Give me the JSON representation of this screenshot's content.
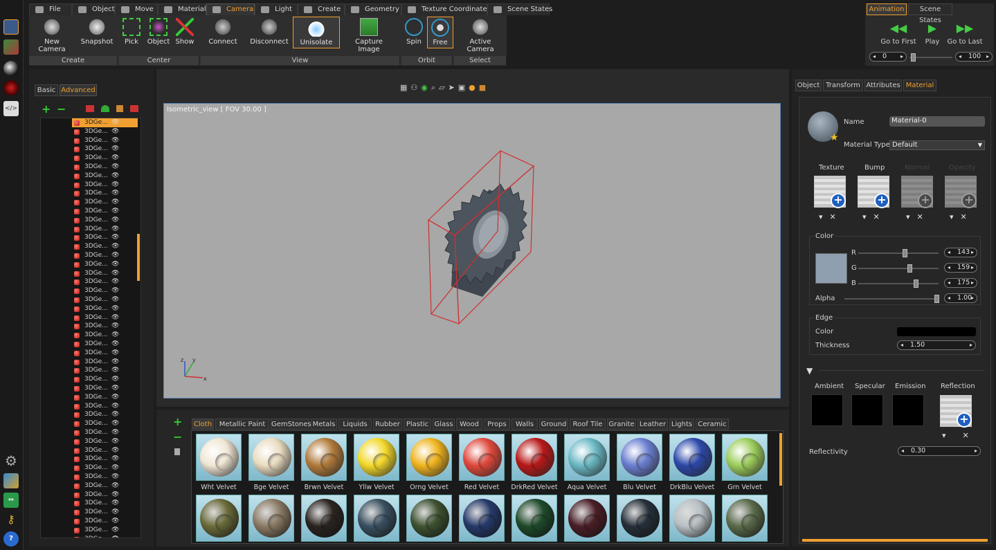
{
  "menu_tabs": [
    {
      "label": "File",
      "icon": "folder-icon"
    },
    {
      "label": "Object",
      "icon": "object-icon"
    },
    {
      "label": "Move",
      "icon": "move-icon"
    },
    {
      "label": "Material",
      "icon": "material-icon"
    },
    {
      "label": "Camera",
      "icon": "camera-icon",
      "active": true
    },
    {
      "label": "Light",
      "icon": "light-icon"
    },
    {
      "label": "Create",
      "icon": "create-icon"
    },
    {
      "label": "Geometry",
      "icon": "geometry-icon"
    },
    {
      "label": "Texture Coordinates",
      "icon": "texture-icon"
    },
    {
      "label": "Scene States",
      "icon": "scene-states-icon"
    }
  ],
  "right_tabs": {
    "animation": "Animation",
    "scene_states": "Scene States"
  },
  "ribbon": {
    "buttons": {
      "new_camera": "New Camera",
      "snapshot": "Snapshot",
      "pick": "Pick",
      "object": "Object",
      "show": "Show",
      "connect": "Connect",
      "disconnect": "Disconnect",
      "unisolate": "Unisolate",
      "capture_image": "Capture Image",
      "spin": "Spin",
      "free": "Free",
      "active_camera": "Active Camera"
    },
    "groups": {
      "create": "Create",
      "center": "Center",
      "view": "View",
      "orbit": "Orbit",
      "select": "Select"
    }
  },
  "animation": {
    "go_first": "Go to First",
    "play": "Play",
    "go_last": "Go to Last",
    "start": "0",
    "end": "100"
  },
  "left_panel": {
    "tabs": {
      "basic": "Basic",
      "advanced": "Advanced"
    },
    "items": [
      "3DGe...",
      "3DGe...",
      "3DGe...",
      "3DGe...",
      "3DGe...",
      "3DGe...",
      "3DGe...",
      "3DGe...",
      "3DGe...",
      "3DGe...",
      "3DGe...",
      "3DGe...",
      "3DGe...",
      "3DGe...",
      "3DGe...",
      "3DGe...",
      "3DGe...",
      "3DGe...",
      "3DGe...",
      "3DGe...",
      "3DGe...",
      "3DGe...",
      "3DGe...",
      "3DGe...",
      "3DGe...",
      "3DGe...",
      "3DGe...",
      "3DGe...",
      "3DGe...",
      "3DGe...",
      "3DGe...",
      "3DGe...",
      "3DGe...",
      "3DGe...",
      "3DGe...",
      "3DGe...",
      "3DGe...",
      "3DGe...",
      "3DGe...",
      "3DGe...",
      "3DGe...",
      "3DGe...",
      "3DGe...",
      "3DGe...",
      "3DGe...",
      "3DGe...",
      "3DGe...",
      "3DGe..."
    ]
  },
  "viewport": {
    "label": "Isometric_view [ FOV 30.00 ]",
    "axis_x": "x",
    "axis_y": "y",
    "axis_z": "z"
  },
  "material_tabs": [
    "Cloth",
    "Metallic Paint",
    "GemStones",
    "Metals",
    "Liquids",
    "Rubber",
    "Plastic",
    "Glass",
    "Wood",
    "Props",
    "Walls",
    "Ground",
    "Roof Tile",
    "Granite",
    "Leather",
    "Lights",
    "Ceramic"
  ],
  "materials": [
    {
      "name": "Wht Velvet",
      "color": "#f0e6d4"
    },
    {
      "name": "Bge Velvet",
      "color": "#e9dcc0"
    },
    {
      "name": "Brwn Velvet",
      "color": "#b07a3a"
    },
    {
      "name": "Yllw Velvet",
      "color": "#f3d82a"
    },
    {
      "name": "Orng Velvet",
      "color": "#f0b41e"
    },
    {
      "name": "Red Velvet",
      "color": "#e0483c"
    },
    {
      "name": "DrkRed Velvet",
      "color": "#b81818"
    },
    {
      "name": "Aqua Velvet",
      "color": "#6ab8c4"
    },
    {
      "name": "Blu Velvet",
      "color": "#6a7ed0"
    },
    {
      "name": "DrkBlu Velvet",
      "color": "#2c48a8"
    },
    {
      "name": "Grn Velvet",
      "color": "#9ccc5a"
    }
  ],
  "materials_row2_colors": [
    "#6a6a3a",
    "#8a7a64",
    "#2a2420",
    "#3a5060",
    "#3e5230",
    "#263a6a",
    "#1e4a2a",
    "#4a1e26",
    "#26303a",
    "#b8c0c4",
    "#5a6a4a"
  ],
  "props": {
    "tabs": {
      "object": "Object",
      "transform": "Transform",
      "attributes": "Attributes",
      "material": "Material"
    },
    "name_label": "Name",
    "name_value": "Material-0",
    "type_label": "Material Type",
    "type_value": "Default",
    "maps": {
      "texture": "Texture",
      "bump": "Bump",
      "normal": "Normal",
      "opacity": "Opacity"
    },
    "color_section": "Color",
    "r_label": "R",
    "g_label": "G",
    "b_label": "B",
    "alpha_label": "Alpha",
    "r": "143",
    "g": "159",
    "b": "175",
    "alpha": "1.00",
    "edge_section": "Edge",
    "edge_color_label": "Color",
    "thickness_label": "Thickness",
    "thickness": "1.50",
    "ambient": "Ambient",
    "specular": "Specular",
    "emission": "Emission",
    "reflection": "Reflection",
    "reflectivity_label": "Reflectivity",
    "reflectivity": "0.30",
    "swatch_color": "#8f9faf"
  },
  "colors": {
    "accent": "#f0a030",
    "bbox": "#d03030",
    "viewport_bg": "#a8a8a8"
  }
}
